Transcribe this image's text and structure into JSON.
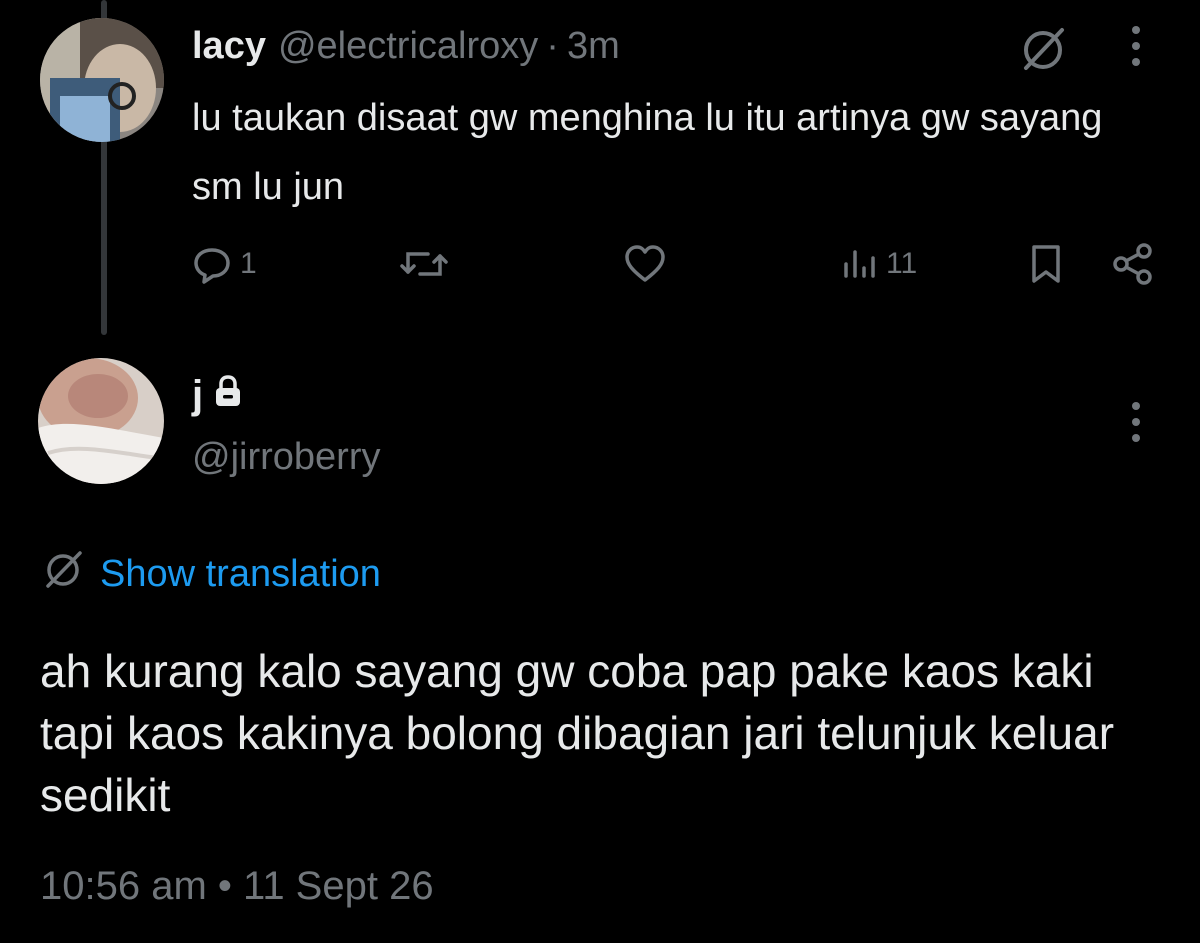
{
  "tweet1": {
    "name": "lacy",
    "handle": "@electricalroxy",
    "dot": "·",
    "time": "3m",
    "text": "lu taukan disaat gw menghina lu itu artinya gw sayang sm lu jun",
    "reply_count": "1",
    "views_count": "11"
  },
  "tweet2": {
    "name": "j",
    "handle": "@jirroberry",
    "show_translation": "Show translation",
    "text": "ah kurang kalo sayang gw coba pap pake kaos kaki tapi kaos kakinya bolong dibagian jari telunjuk keluar sedikit",
    "time": "10:56 am",
    "separator": "•",
    "date": "11 Sept 26"
  },
  "icons": {
    "translate": "globe-slash-icon",
    "more": "more-vertical-icon",
    "reply": "reply-icon",
    "retweet": "retweet-icon",
    "like": "heart-icon",
    "views": "views-icon",
    "bookmark": "bookmark-icon",
    "share": "share-icon",
    "lock": "lock-icon"
  },
  "colors": {
    "background": "#000000",
    "text": "#e7e9ea",
    "muted": "#71767b",
    "link": "#1d9bf0"
  }
}
